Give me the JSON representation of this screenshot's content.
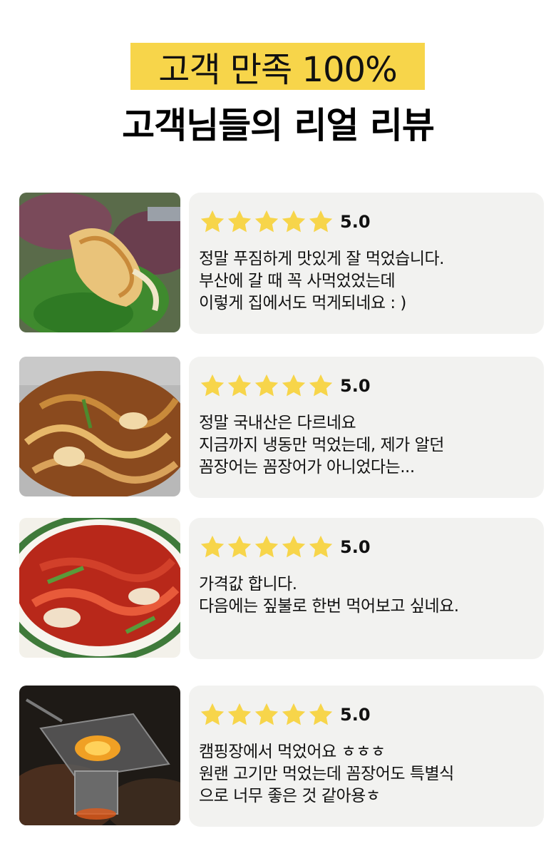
{
  "header": {
    "title_top": "고객 만족 100%",
    "title_main": "고객님들의 리얼 리뷰"
  },
  "colors": {
    "highlight": "#f7d54a",
    "star": "#f7d54a",
    "card_bg": "#f2f2f0"
  },
  "reviews": [
    {
      "rating": "5.0",
      "stars": 5,
      "lines": [
        "정말 푸짐하게 맛있게 잘 먹었습니다.",
        "부산에 갈 때 꼭 사먹었었는데",
        "이렇게 집에서도 먹게되네요 : )"
      ],
      "photo": "grilled-eel-on-lettuce"
    },
    {
      "rating": "5.0",
      "stars": 5,
      "lines": [
        "정말 국내산은 다르네요",
        "지금까지 냉동만 먹었는데, 제가 알던",
        "꼼장어는 꼼장어가 아니었다는..."
      ],
      "photo": "stir-fried-eel-on-foil"
    },
    {
      "rating": "5.0",
      "stars": 5,
      "lines": [
        "가격값 합니다.",
        "다음에는 짚불로 한번 먹어보고 싶네요."
      ],
      "photo": "spicy-eel-on-plate"
    },
    {
      "rating": "5.0",
      "stars": 5,
      "lines": [
        "캠핑장에서 먹었어요 ㅎㅎㅎ",
        "원랜 고기만 먹었는데 꼼장어도 특별식",
        "으로 너무 좋은 것 같아용ㅎ"
      ],
      "photo": "campfire-grill"
    }
  ]
}
